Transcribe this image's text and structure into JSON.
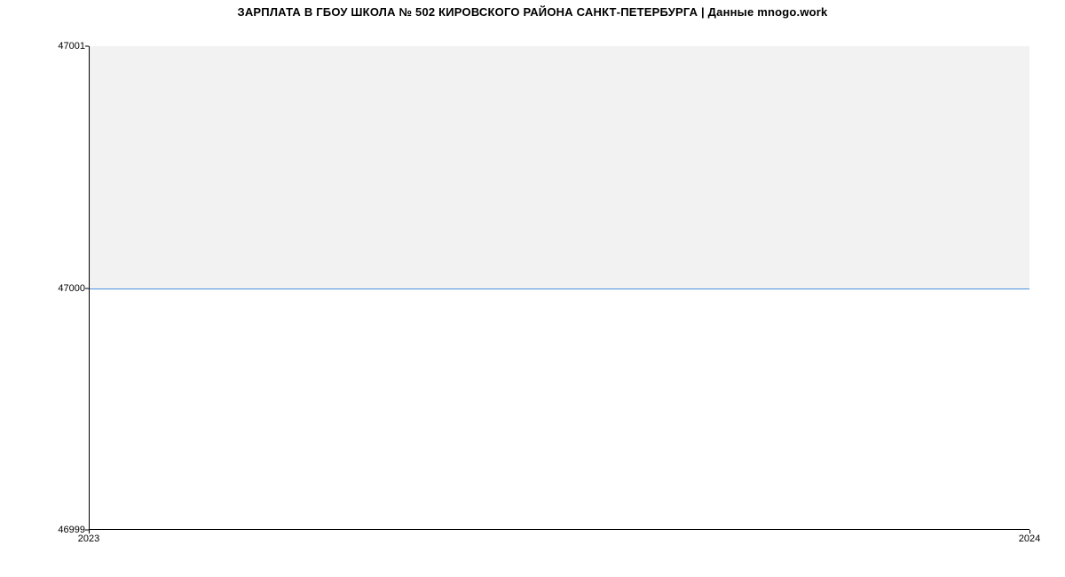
{
  "chart_data": {
    "type": "area",
    "title": "ЗАРПЛАТА В ГБОУ ШКОЛА № 502 КИРОВСКОГО РАЙОНА САНКТ-ПЕТЕРБУРГА | Данные mnogo.work",
    "x": [
      2023,
      2024
    ],
    "values": [
      47000,
      47000
    ],
    "xlabel": "",
    "ylabel": "",
    "xticks": [
      "2023",
      "2024"
    ],
    "yticks": [
      "46999",
      "47000",
      "47001"
    ],
    "ylim": [
      46999,
      47001
    ],
    "xlim": [
      2023,
      2024
    ],
    "line_color": "#4a90e2",
    "fill_color": "#f2f2f2"
  }
}
